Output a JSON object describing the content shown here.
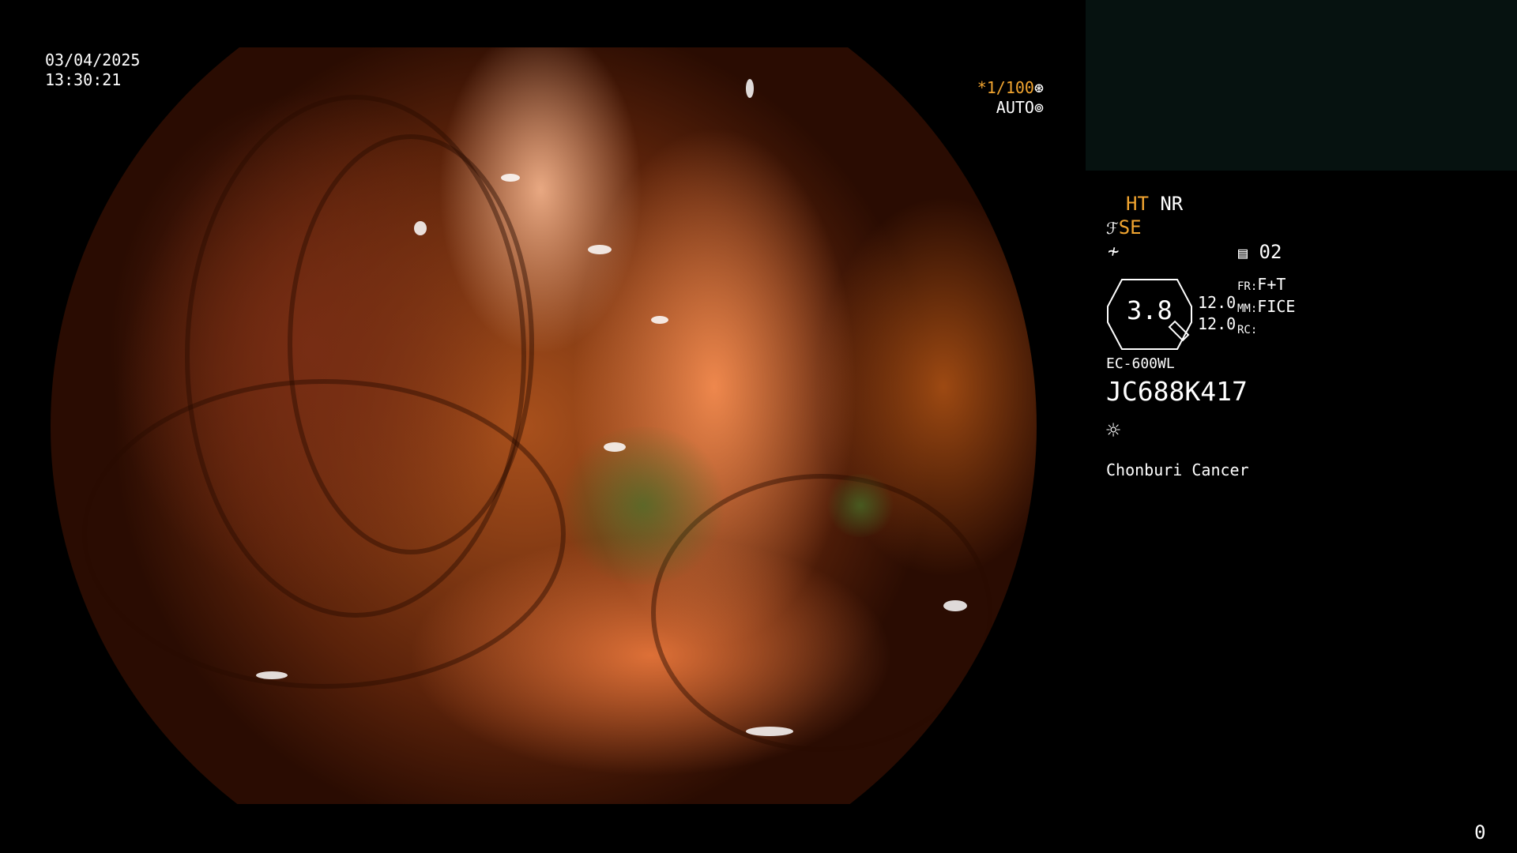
{
  "timestamp": {
    "date": "03/04/2025",
    "time": "13:30:21"
  },
  "shutter": {
    "value": "*1/100",
    "mode": "AUTO"
  },
  "settings": {
    "ht": "HT",
    "nr": "NR",
    "se": "SE",
    "memory": "02",
    "zoom": "3.8",
    "left_value_1": "12.0",
    "left_value_2": "12.0",
    "fr_label": "FR:",
    "fr_value": "F+T",
    "mm_label": "MM:",
    "mm_value": "FICE",
    "rc_label": "RC:"
  },
  "scope_model": "EC-600WL",
  "serial": "JC688K417",
  "institution": "Chonburi Cancer",
  "counter": "0",
  "icons": [
    "aperture-icon",
    "settings-icon",
    "enhance-icon",
    "freeze-icon",
    "memory-icon",
    "lamp-icon"
  ],
  "colors": {
    "accent": "#f2a530",
    "background": "#000000",
    "thumbnail": "#061210"
  }
}
